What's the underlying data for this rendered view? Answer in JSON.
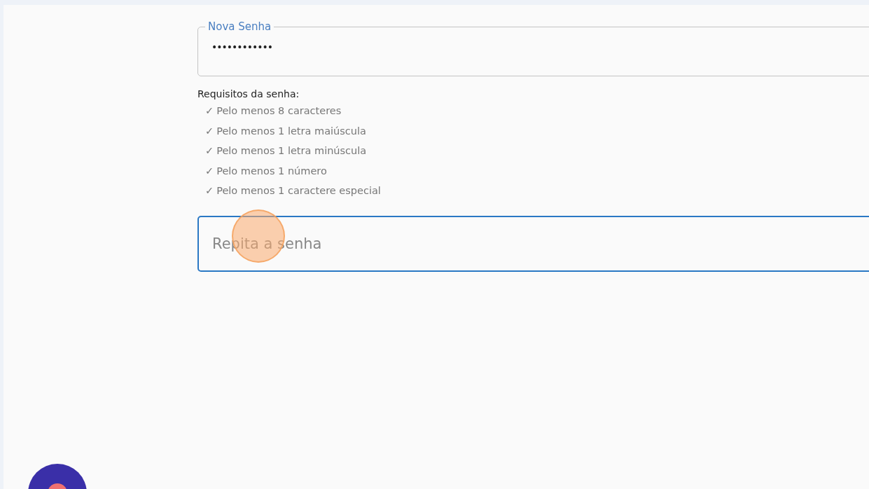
{
  "new_password": {
    "label": "Nova Senha",
    "value": "••••••••••••",
    "focused": false
  },
  "requirements": {
    "title": "Requisitos da senha:",
    "items": [
      {
        "mark": "✓",
        "text": "Pelo menos 8 caracteres"
      },
      {
        "mark": "✓",
        "text": "Pelo menos 1 letra maiúscula"
      },
      {
        "mark": "✓",
        "text": "Pelo menos 1 letra minúscula"
      },
      {
        "mark": "✓",
        "text": "Pelo menos 1 número"
      },
      {
        "mark": "✓",
        "text": "Pelo menos 1 caractere especial"
      }
    ]
  },
  "repeat_password": {
    "placeholder": "Repita a senha",
    "focused": true,
    "click_highlight": true
  }
}
